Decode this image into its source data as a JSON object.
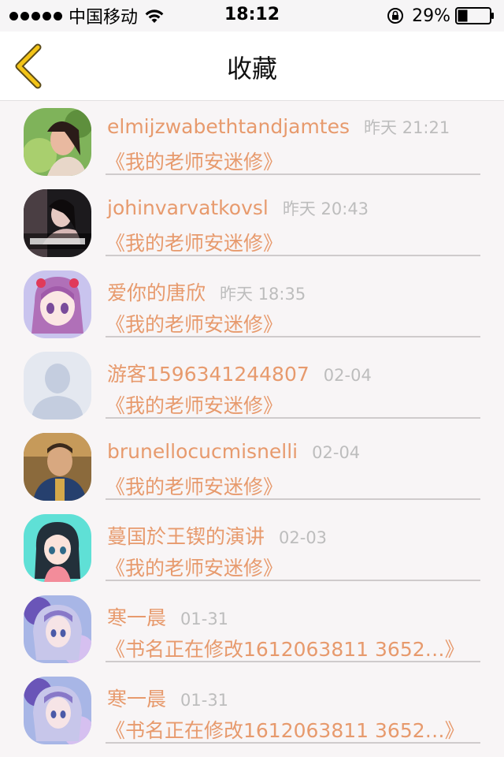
{
  "status_bar": {
    "carrier": "中国移动",
    "time": "18:12",
    "battery": "29%",
    "icons": [
      "signal-dots-icon",
      "wifi-icon",
      "rotation-lock-icon",
      "battery-icon"
    ]
  },
  "nav": {
    "title": "收藏",
    "back_icon": "chevron-left-icon",
    "accent": "#f3c417"
  },
  "favorites": [
    {
      "user": "elmijzwabethtandjamtes",
      "time": "昨天 21:21",
      "book": "《我的老师安迷修》",
      "avatar": "photo-woman"
    },
    {
      "user": "johinvarvatkovsl",
      "time": "昨天 20:43",
      "book": "《我的老师安迷修》",
      "avatar": "photo-dark"
    },
    {
      "user": "爱你的唐欣",
      "time": "昨天 18:35",
      "book": "《我的老师安迷修》",
      "avatar": "anime-pink"
    },
    {
      "user": "游客1596341244807",
      "time": "02-04",
      "book": "《我的老师安迷修》",
      "avatar": "default-silhouette"
    },
    {
      "user": "brunellocucmisnelli",
      "time": "02-04",
      "book": "《我的老师安迷修》",
      "avatar": "photo-man"
    },
    {
      "user": "蔓国於王锲的演讲",
      "time": "02-03",
      "book": "《我的老师安迷修》",
      "avatar": "anime-teal"
    },
    {
      "user": "寒一晨",
      "time": "01-31",
      "book": "《书名正在修改1612063811 3652…》",
      "avatar": "anime-purple"
    },
    {
      "user": "寒一晨",
      "time": "01-31",
      "book": "《书名正在修改1612063811 3652…》",
      "avatar": "anime-purple"
    }
  ],
  "colors": {
    "username": "#e79a6d",
    "time": "#bdbdbd",
    "background": "#f8f5f6"
  }
}
